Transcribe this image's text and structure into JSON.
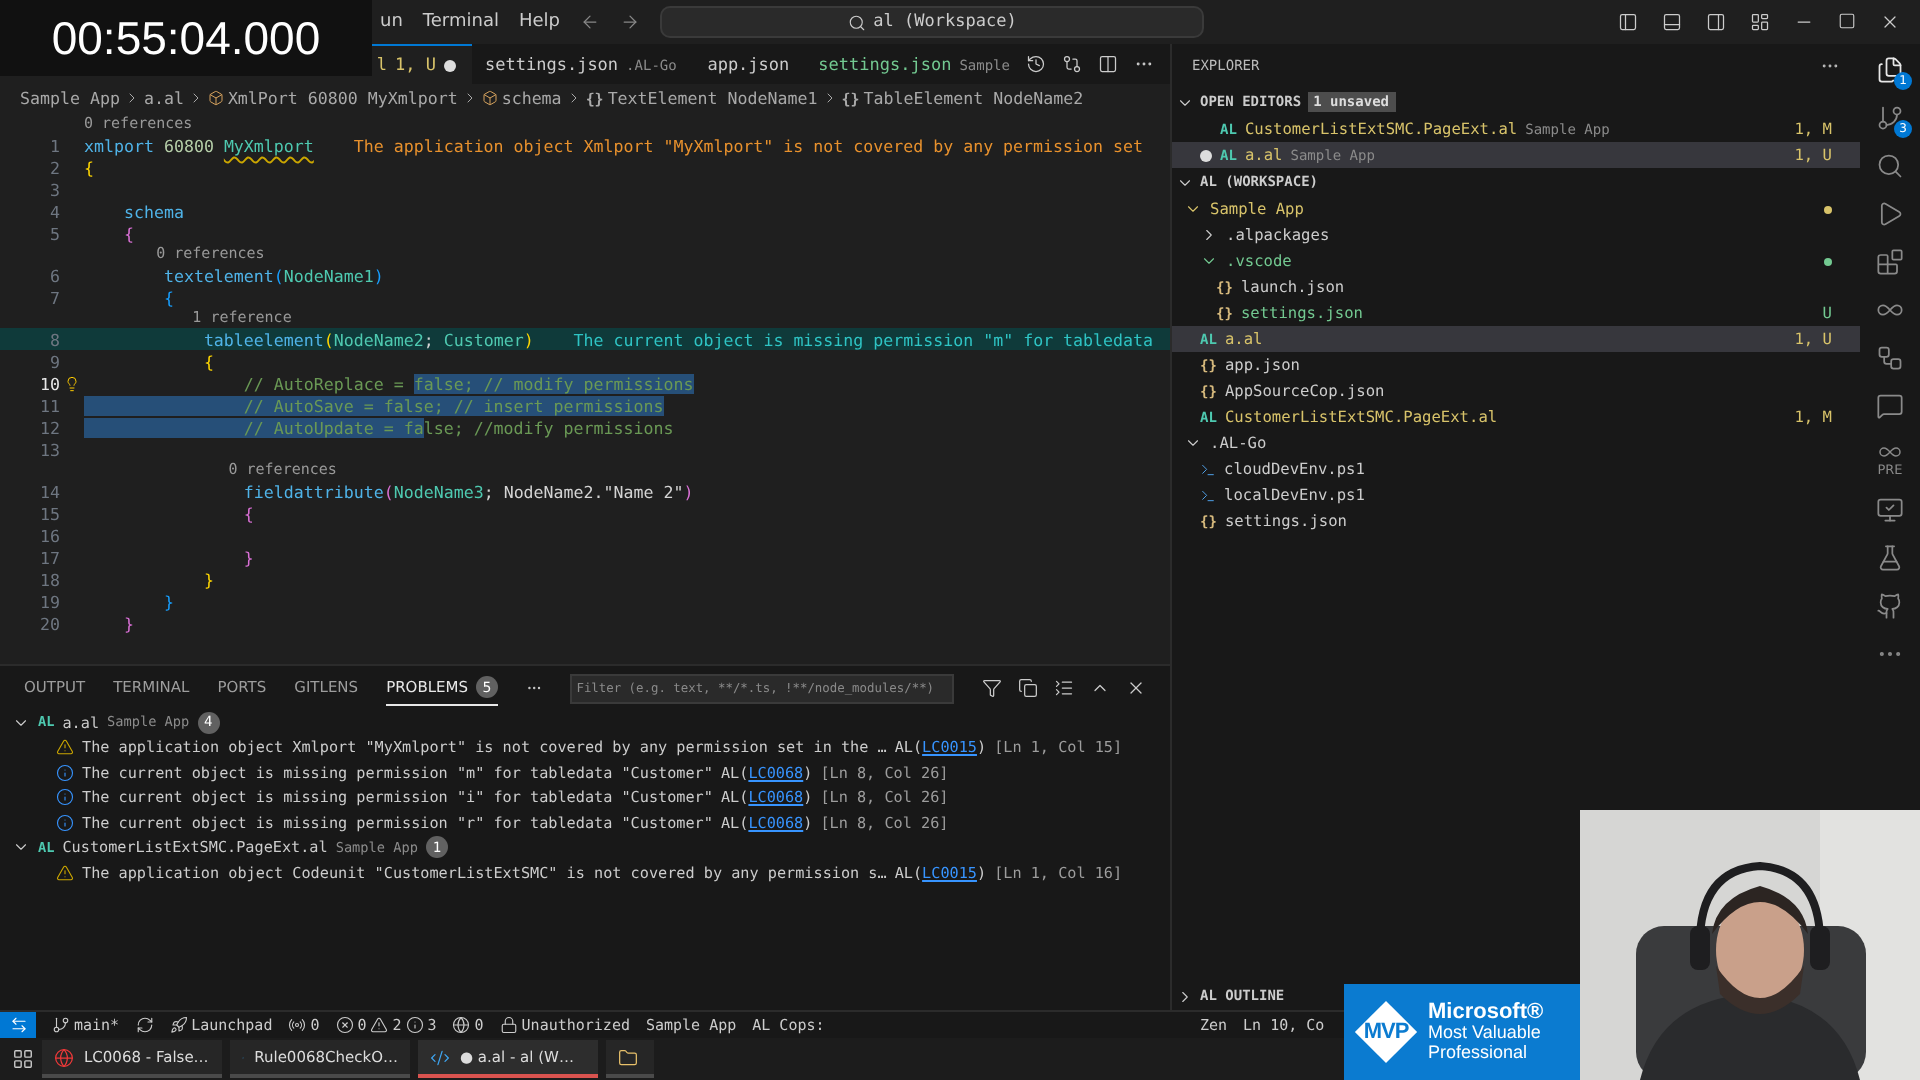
{
  "timestamp": "00:55:04.000",
  "menu": [
    "un",
    "Terminal",
    "Help"
  ],
  "command_center": "al (Workspace)",
  "tabs": [
    {
      "name": "l",
      "status": "1, U",
      "color": "#d8c36a",
      "modified": true,
      "selected": true
    },
    {
      "name": "settings.json",
      "description": ".AL-Go",
      "color": "#cccccc",
      "modified": false,
      "selected": false
    },
    {
      "name": "app.json",
      "color": "#cccccc",
      "modified": false,
      "selected": false
    },
    {
      "name": "settings.json",
      "description": "Sample",
      "color": "#73c991",
      "modified": false,
      "selected": false
    }
  ],
  "breadcrumb": [
    {
      "kind": "text",
      "text": "Sample App"
    },
    {
      "kind": "text",
      "text": "a.al"
    },
    {
      "kind": "symbol",
      "text": "XmlPort 60800 MyXmlport"
    },
    {
      "kind": "symbol",
      "text": "schema"
    },
    {
      "kind": "glyph",
      "glyph": "{}",
      "text": "TextElement NodeName1"
    },
    {
      "kind": "glyph",
      "glyph": "{}",
      "text": "TableElement NodeName2"
    }
  ],
  "code": [
    {
      "number": "1",
      "lens": "0 references",
      "current": false,
      "tokens": [
        {
          "kind": "keyword",
          "text": "xmlport"
        },
        {
          "kind": "number",
          "text": " 60800 "
        },
        {
          "kind": "squiggle",
          "text": "MyXmlport"
        }
      ],
      "message": {
        "kind": "warning",
        "text": "The application object Xmlport \"MyXmlport\" is not covered by any permission set"
      }
    },
    {
      "number": "2",
      "current": false,
      "tokens": [
        {
          "kind": "bracket1",
          "text": "{"
        }
      ]
    },
    {
      "number": "3",
      "current": false
    },
    {
      "number": "4",
      "current": false,
      "tokens": [
        {
          "kind": "keyword",
          "text": "    schema"
        }
      ]
    },
    {
      "number": "5",
      "current": false,
      "tokens": [
        {
          "kind": "bracket2",
          "text": "    {"
        }
      ]
    },
    {
      "number": "6",
      "lens": "0 references",
      "current": false,
      "tokens": [
        {
          "kind": "keyword",
          "text": "        textelement"
        },
        {
          "kind": "bracket3",
          "text": "("
        },
        {
          "kind": "name",
          "text": "NodeName1"
        },
        {
          "kind": "bracket3",
          "text": ")"
        }
      ]
    },
    {
      "number": "7",
      "current": false,
      "tokens": [
        {
          "kind": "bracket3",
          "text": "        {"
        }
      ]
    },
    {
      "number": "8",
      "lens": "1 reference",
      "current": false,
      "tokens": [
        {
          "kind": "keyword",
          "text": "            tableelement"
        },
        {
          "kind": "bracket1",
          "text": "("
        },
        {
          "kind": "name",
          "text": "NodeName2"
        },
        {
          "kind": "plain",
          "text": "; "
        },
        {
          "kind": "name",
          "text": "Customer"
        },
        {
          "kind": "bracket1",
          "text": ")"
        }
      ],
      "message": {
        "kind": "info",
        "text": "The current object is missing permission \"m\" for tabledata"
      }
    },
    {
      "number": "9",
      "current": false,
      "tokens": [
        {
          "kind": "bracket1",
          "text": "            {"
        }
      ]
    },
    {
      "number": "10",
      "current": true,
      "lightbulb": true,
      "tokens": [
        {
          "kind": "comment",
          "text": "                // AutoReplace = ",
          "selected": false
        },
        {
          "kind": "comment",
          "text": "false; // modify permissions",
          "selected": true
        }
      ]
    },
    {
      "number": "11",
      "current": false,
      "tokens": [
        {
          "kind": "comment",
          "text": "                // AutoSave = false; // insert permissions",
          "selected": true
        }
      ]
    },
    {
      "number": "12",
      "current": false,
      "tokens": [
        {
          "kind": "comment",
          "text": "                // AutoUpdate = fa",
          "selected": true
        },
        {
          "kind": "comment",
          "text": "lse; //modify permissions",
          "selected": false
        }
      ]
    },
    {
      "number": "13",
      "current": false
    },
    {
      "number": "14",
      "lens": "0 references",
      "current": false,
      "tokens": [
        {
          "kind": "keyword",
          "text": "                fieldattribute"
        },
        {
          "kind": "bracket2",
          "text": "("
        },
        {
          "kind": "name",
          "text": "NodeName3"
        },
        {
          "kind": "plain",
          "text": "; NodeName2.\"Name 2\""
        },
        {
          "kind": "bracket2",
          "text": ")"
        }
      ]
    },
    {
      "number": "15",
      "current": false,
      "tokens": [
        {
          "kind": "bracket2",
          "text": "                {"
        }
      ]
    },
    {
      "number": "16",
      "current": false
    },
    {
      "number": "17",
      "current": false,
      "tokens": [
        {
          "kind": "bracket2",
          "text": "                }"
        }
      ]
    },
    {
      "number": "18",
      "current": false,
      "tokens": [
        {
          "kind": "bracket1",
          "text": "            }"
        }
      ]
    },
    {
      "number": "19",
      "current": false,
      "tokens": [
        {
          "kind": "bracket3",
          "text": "        }"
        }
      ]
    },
    {
      "number": "20",
      "current": false,
      "tokens": [
        {
          "kind": "bracket2",
          "text": "    }"
        }
      ]
    }
  ],
  "panel": {
    "tabs": [
      {
        "label": "OUTPUT",
        "selected": false
      },
      {
        "label": "TERMINAL",
        "selected": false
      },
      {
        "label": "PORTS",
        "selected": false
      },
      {
        "label": "GITLENS",
        "selected": false
      },
      {
        "label": "PROBLEMS",
        "badge": "5",
        "selected": true
      }
    ],
    "filter_placeholder": "Filter (e.g. text, **/*.ts, !**/node_modules/**)",
    "groups": [
      {
        "glyph": "AL",
        "file": "a.al",
        "description": "Sample App",
        "count": "4",
        "expanded": true,
        "problems": [
          {
            "kind": "warning",
            "message": "The application object Xmlport \"MyXmlport\" is not covered by any permission set in the …",
            "source_open": "AL(",
            "code": "LC0015",
            "source_close": ")",
            "location": "[Ln 1, Col 15]"
          },
          {
            "kind": "info",
            "message": "The current object is missing permission \"m\" for tabledata \"Customer\"",
            "source_open": "AL(",
            "code": "LC0068",
            "source_close": ")",
            "location": "[Ln 8, Col 26]"
          },
          {
            "kind": "info",
            "message": "The current object is missing permission \"i\" for tabledata \"Customer\"",
            "source_open": "AL(",
            "code": "LC0068",
            "source_close": ")",
            "location": "[Ln 8, Col 26]"
          },
          {
            "kind": "info",
            "message": "The current object is missing permission \"r\" for tabledata \"Customer\"",
            "source_open": "AL(",
            "code": "LC0068",
            "source_close": ")",
            "location": "[Ln 8, Col 26]"
          }
        ]
      },
      {
        "glyph": "AL",
        "file": "CustomerListExtSMC.PageExt.al",
        "description": "Sample App",
        "count": "1",
        "expanded": true,
        "problems": [
          {
            "kind": "warning",
            "message": "The application object Codeunit \"CustomerListExtSMC\" is not covered by any permission s…",
            "source_open": "AL(",
            "code": "LC0015",
            "source_close": ")",
            "location": "[Ln 1, Col 16]"
          }
        ]
      }
    ]
  },
  "explorer": {
    "title": "EXPLORER",
    "open_editors": {
      "title": "OPEN EDITORS",
      "badge": "1 unsaved",
      "expanded": true,
      "items": [
        {
          "glyph": "AL",
          "name": "CustomerListExtSMC.PageExt.al",
          "description": "Sample App",
          "status": "1, M",
          "color": "#d8c36a",
          "dirty": false,
          "selected": false
        },
        {
          "glyph": "AL",
          "name": "a.al",
          "description": "Sample App",
          "status": "1, U",
          "color": "#d8c36a",
          "dirty": true,
          "selected": true
        }
      ]
    },
    "workspace": {
      "title": "AL (WORKSPACE)",
      "expanded": true,
      "items": [
        {
          "kind": "folder",
          "name": "Sample App",
          "color": "#d8c36a",
          "dot": true,
          "expanded": true,
          "selected": false,
          "children": [
            {
              "kind": "folder",
              "name": ".alpackages",
              "color": "#cccccc",
              "dot": false,
              "expanded": false,
              "selected": false
            },
            {
              "kind": "folder",
              "name": ".vscode",
              "color": "#73c991",
              "dot": true,
              "expanded": true,
              "selected": false,
              "children": [
                {
                  "kind": "file",
                  "glyph": "{}",
                  "name": "launch.json",
                  "color": "#cccccc",
                  "selected": false
                },
                {
                  "kind": "file",
                  "glyph": "{}",
                  "name": "settings.json",
                  "status": "U",
                  "color": "#73c991",
                  "selected": false
                }
              ]
            },
            {
              "kind": "file",
              "glyph": "AL",
              "name": "a.al",
              "status": "1, U",
              "color": "#d8c36a",
              "selected": true
            },
            {
              "kind": "file",
              "glyph": "{}",
              "name": "app.json",
              "color": "#cccccc",
              "selected": false
            },
            {
              "kind": "file",
              "glyph": "{}",
              "name": "AppSourceCop.json",
              "color": "#cccccc",
              "selected": false
            },
            {
              "kind": "file",
              "glyph": "AL",
              "name": "CustomerListExtSMC.PageExt.al",
              "status": "1, M",
              "color": "#d8c36a",
              "selected": false
            }
          ]
        },
        {
          "kind": "folder",
          "name": ".AL-Go",
          "color": "#cccccc",
          "dot": false,
          "expanded": true,
          "selected": false,
          "children": [
            {
              "kind": "script",
              "name": "cloudDevEnv.ps1",
              "color": "#cccccc",
              "selected": false
            },
            {
              "kind": "script",
              "name": "localDevEnv.ps1",
              "color": "#cccccc",
              "selected": false
            },
            {
              "kind": "file",
              "glyph": "{}",
              "name": "settings.json",
              "color": "#cccccc",
              "selected": false
            }
          ]
        }
      ]
    },
    "outline": {
      "title": "AL OUTLINE",
      "expanded": false
    }
  },
  "activity": [
    {
      "kind": "files",
      "badge": "1",
      "selected": true
    },
    {
      "kind": "source-control",
      "badge": "3",
      "selected": false
    },
    {
      "kind": "search",
      "selected": false
    },
    {
      "kind": "run",
      "selected": false
    },
    {
      "kind": "extensions",
      "selected": false
    },
    {
      "kind": "infinity",
      "selected": false
    },
    {
      "kind": "flow",
      "selected": false
    },
    {
      "kind": "chat",
      "selected": false
    },
    {
      "kind": "pre",
      "label": "PRE",
      "selected": false
    },
    {
      "kind": "remote",
      "selected": false
    },
    {
      "kind": "test",
      "selected": false
    },
    {
      "kind": "github",
      "selected": false
    },
    {
      "kind": "more",
      "selected": false
    }
  ],
  "status_bar": {
    "left": [
      {
        "kind": "remote"
      },
      {
        "kind": "branch",
        "text": "main*"
      },
      {
        "kind": "sync"
      },
      {
        "kind": "launchpad",
        "text": "Launchpad"
      },
      {
        "kind": "ports",
        "text": "0"
      },
      {
        "kind": "problems",
        "errors": "0",
        "warnings": "2",
        "infos": "3"
      },
      {
        "kind": "radio",
        "text": "0"
      },
      {
        "kind": "lock",
        "text": "Unauthorized"
      },
      {
        "kind": "text",
        "text": "Sample App"
      },
      {
        "kind": "text",
        "text": "AL Cops:"
      }
    ],
    "right": [
      "Zen",
      "Ln 10, Co"
    ]
  },
  "taskbar": [
    {
      "kind": "browser",
      "label": "LC0068 - False…",
      "selected": false
    },
    {
      "kind": "vscode",
      "label": "Rule0068CheckO…",
      "selected": false
    },
    {
      "kind": "vscode",
      "label": "● a.al - al (W…",
      "selected": true
    },
    {
      "kind": "folder",
      "selected": false
    }
  ],
  "mvp": {
    "brand": "Microsoft®",
    "lines": [
      "Most Valuable",
      "Professional"
    ],
    "mark": "MVP"
  },
  "webcam": {
    "kind": "picture"
  }
}
